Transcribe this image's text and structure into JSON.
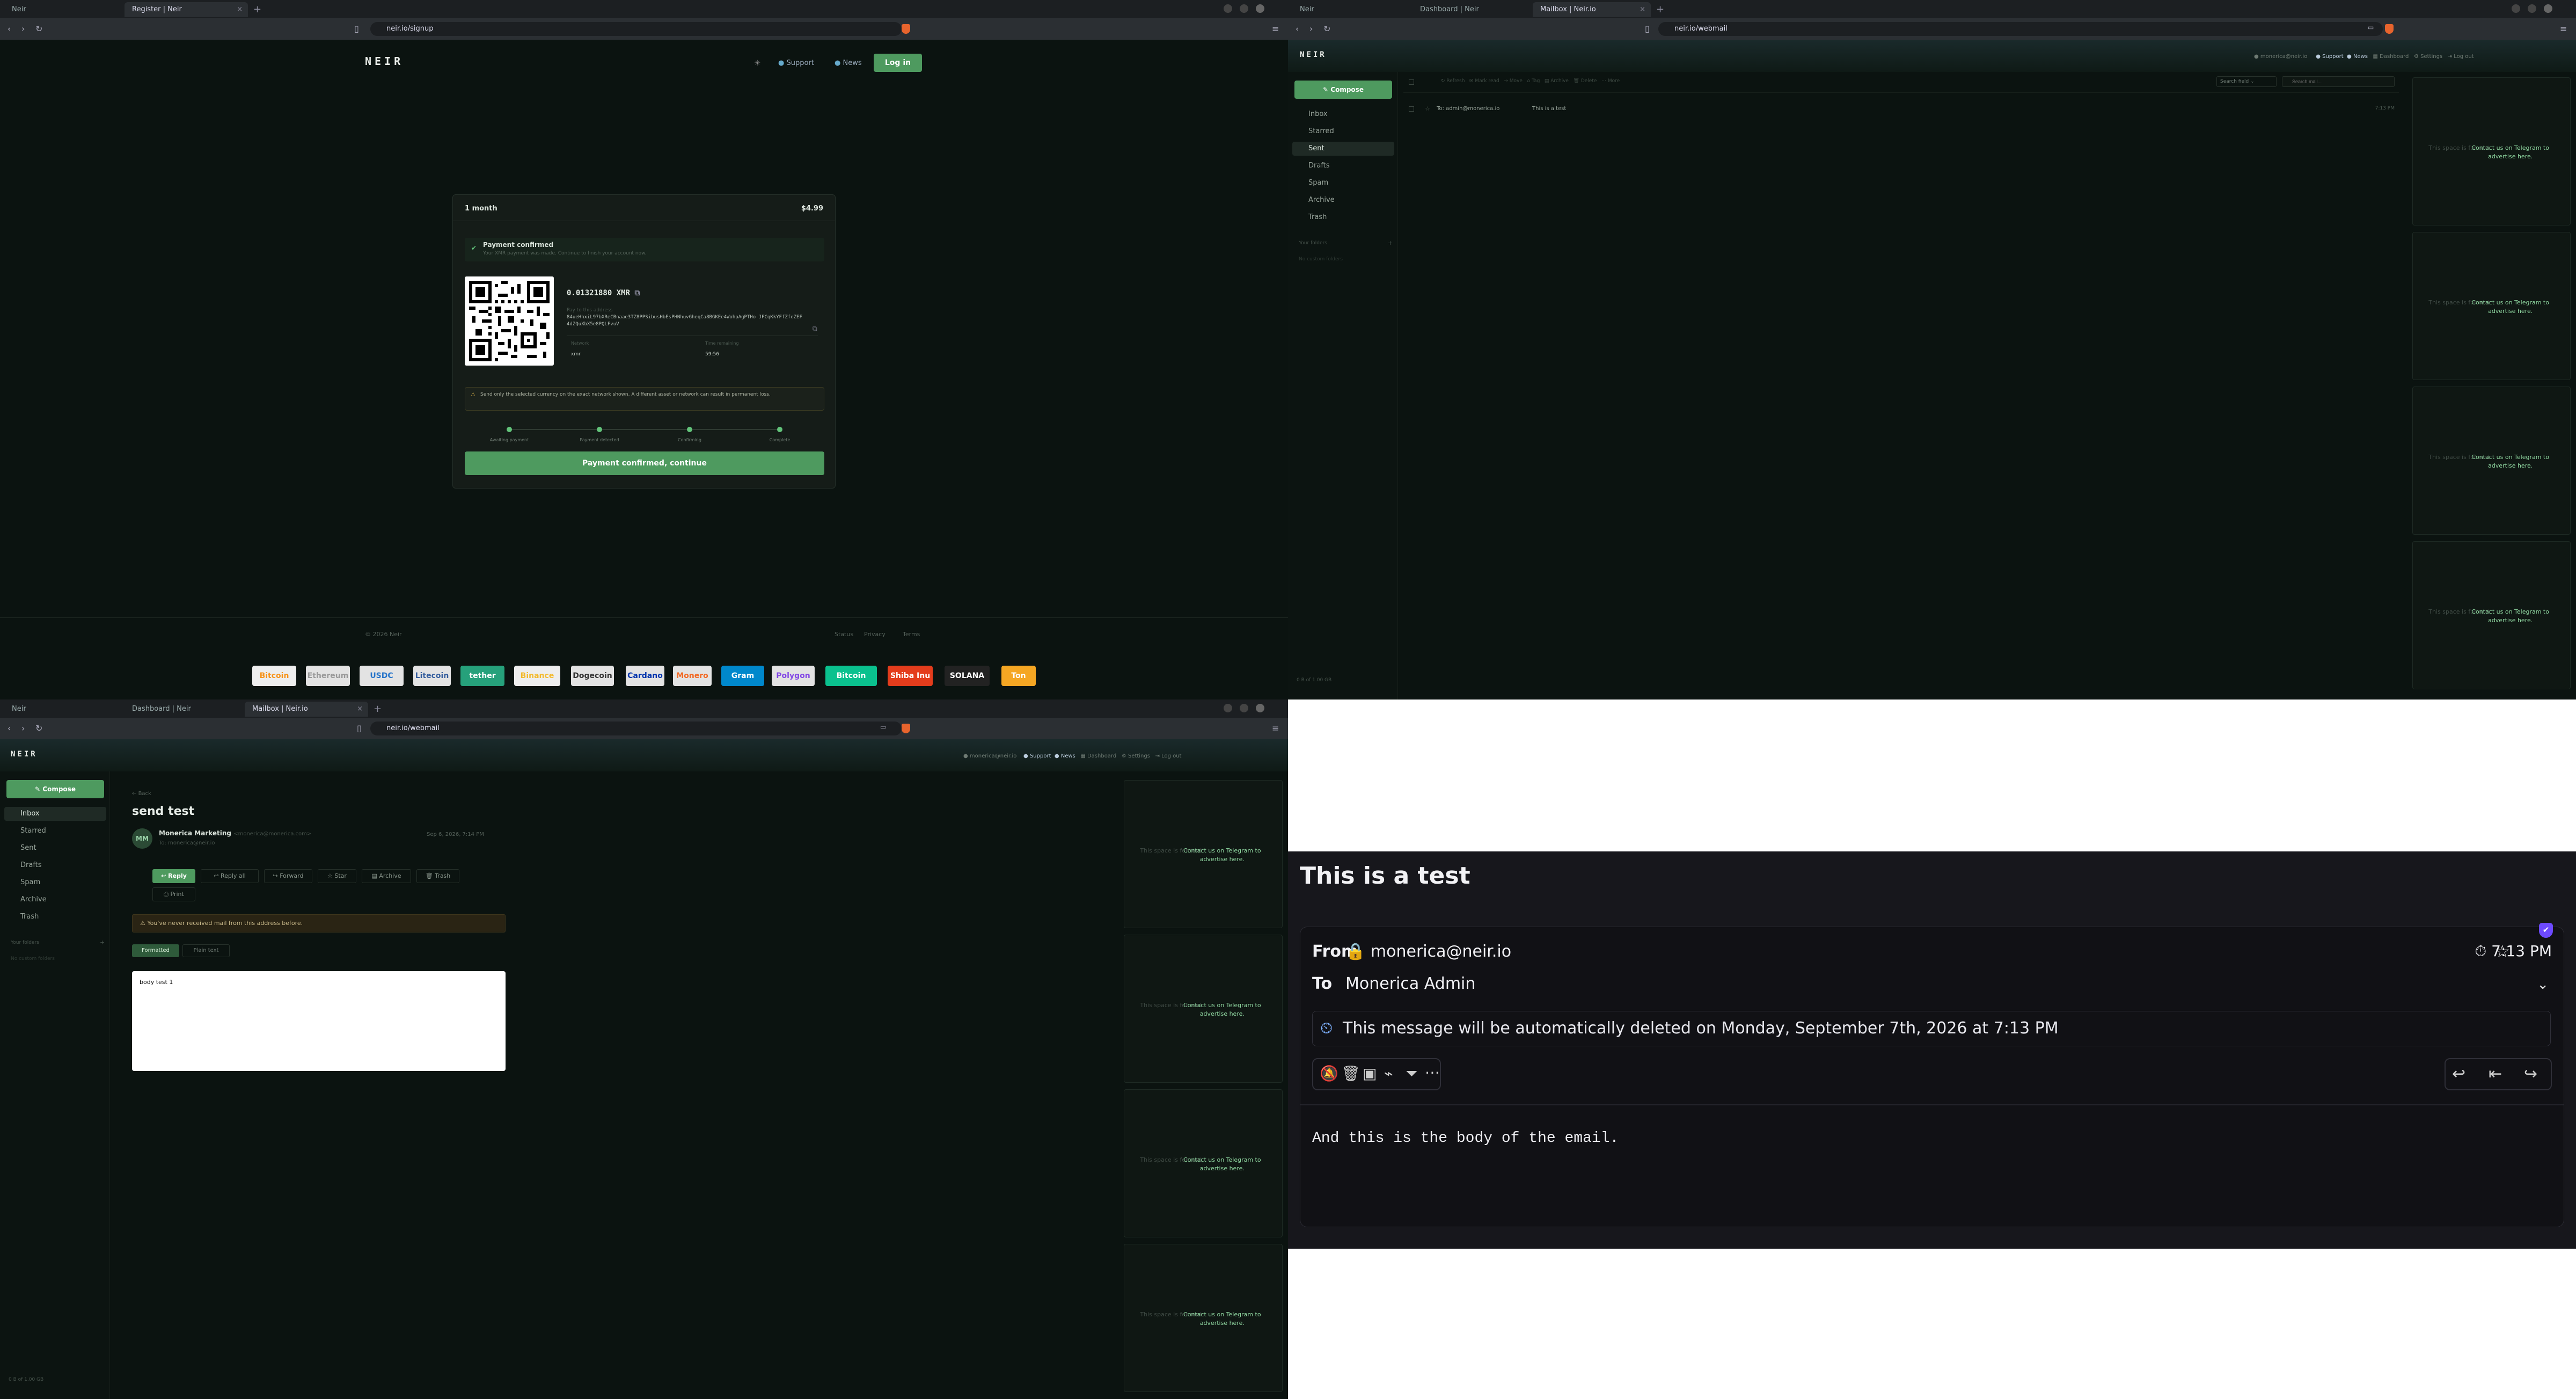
{
  "q1": {
    "tabs": [
      {
        "label": "Neir"
      },
      {
        "label": "Register | Neir"
      }
    ],
    "url": "neir.io/signup",
    "logo": "NEIR",
    "nav": {
      "support": "Support",
      "news": "News",
      "login": "Log in"
    },
    "card": {
      "plan": "1 month",
      "price": "$4.99",
      "status_title": "Payment confirmed",
      "status_sub": "Your XMR payment was made. Continue to finish your account now.",
      "amount": "0.01321880 XMR",
      "addr_label": "Pay to this address",
      "address": "84ueHhxiL97bXReCBnaae3TZ8PPSibusHbEsPHNhuvGheqCa8BGKEe4WohpAgPTHo JFCqKkYFfZfeZEF4dZQuXbX5e8PQLFvuV",
      "f1_label": "Network",
      "f1_value": "xmr",
      "f2_label": "Time remaining",
      "f2_value": "59:56",
      "warning": "Send only the selected currency on the exact network shown. A different asset or network can result in permanent loss.",
      "steps": [
        "Awaiting payment",
        "Payment detected",
        "Confirming",
        "Complete"
      ],
      "continue": "Payment confirmed, continue"
    },
    "footer": {
      "copy": "© 2026 Neir",
      "links": [
        "Status",
        "Privacy",
        "Terms"
      ]
    },
    "cryptos": [
      "Bitcoin",
      "Ethereum",
      "USDC",
      "Litecoin",
      "tether",
      "Binance",
      "Dogecoin",
      "Cardano",
      "Monero",
      "Gram",
      "Polygon",
      "Bitcoin Cash",
      "Shiba Inu",
      "SOLANA",
      "Ton"
    ]
  },
  "q2": {
    "tabs": [
      {
        "label": "Neir"
      },
      {
        "label": "Dashboard | Neir"
      },
      {
        "label": "Mailbox | Neir.io"
      }
    ],
    "url": "neir.io/webmail",
    "logo": "NEIR",
    "header": {
      "user": "monerica@neir.io",
      "support": "Support",
      "news": "News",
      "dashboard": "Dashboard",
      "settings": "Settings",
      "logout": "Log out"
    },
    "compose": "Compose",
    "folders": [
      "Inbox",
      "Starred",
      "Sent",
      "Drafts",
      "Spam",
      "Archive",
      "Trash"
    ],
    "your_folders": "Your folders",
    "no_custom": "No custom folders",
    "toolbar": [
      "Refresh",
      "Mark read",
      "Move",
      "Tag",
      "Archive",
      "Delete",
      "More"
    ],
    "search_field": "Search field",
    "search_placeholder": "Search mail...",
    "message_row": {
      "to": "To: admin@monerica.io",
      "subject": "This is a test",
      "time": "7:13 PM"
    },
    "storage": "0 B of 1.00 GB",
    "ad_text": "This space is for rent",
    "ad_cta": "Contact us on Telegram to advertise here."
  },
  "q3": {
    "tabs": [
      {
        "label": "Neir"
      },
      {
        "label": "Dashboard | Neir"
      },
      {
        "label": "Mailbox | Neir.io"
      }
    ],
    "url": "neir.io/webmail",
    "logo": "NEIR",
    "header": {
      "user": "monerica@neir.io",
      "support": "Support",
      "news": "News",
      "dashboard": "Dashboard",
      "settings": "Settings",
      "logout": "Log out"
    },
    "compose": "Compose",
    "folders": [
      "Inbox",
      "Starred",
      "Sent",
      "Drafts",
      "Spam",
      "Archive",
      "Trash"
    ],
    "your_folders": "Your folders",
    "no_custom": "No custom folders",
    "back": "Back",
    "subject": "send test",
    "avatar": "MM",
    "sender": "Monerica Marketing",
    "sender_email": "<monerica@monerica.com>",
    "to_line": "To: monerica@neir.io",
    "date": "Sep 6, 2026, 7:14 PM",
    "actions": [
      "Reply",
      "Reply all",
      "Forward",
      "Star",
      "Archive",
      "Trash",
      "Print"
    ],
    "notice": "You've never received mail from this address before.",
    "view_tabs": [
      "Formatted",
      "Plain text"
    ],
    "body": "body test 1",
    "storage": "0 B of 1.00 GB",
    "ad_text": "This space is for rent",
    "ad_cta": "Contact us on Telegram to advertise here."
  },
  "q4": {
    "title": "This is a test",
    "from_label": "From",
    "from_value": "monerica@neir.io",
    "to_label": "To",
    "to_value": "Monerica Admin",
    "time": "7:13 PM",
    "notice": "This message will be automatically deleted on Monday, September 7th, 2026 at 7:13 PM",
    "body": "And this is the body of the email."
  }
}
